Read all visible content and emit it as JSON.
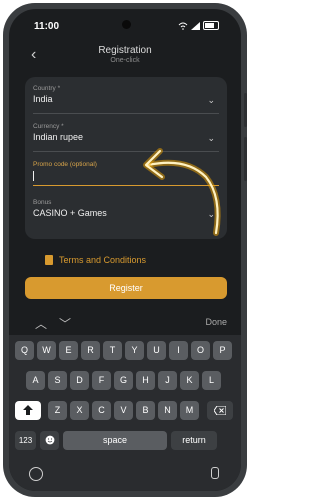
{
  "status_bar": {
    "time": "11:00"
  },
  "header": {
    "title": "Registration",
    "subtitle": "One-click"
  },
  "form": {
    "country": {
      "label": "Country *",
      "value": "India"
    },
    "currency": {
      "label": "Currency *",
      "value": "Indian rupee"
    },
    "promo": {
      "label": "Promo code (optional)",
      "value": ""
    },
    "bonus": {
      "label": "Bonus",
      "value": "CASINO + Games"
    }
  },
  "terms_label": "Terms and Conditions",
  "register_label": "Register",
  "accessory": {
    "done_label": "Done"
  },
  "keyboard": {
    "row1": [
      "Q",
      "W",
      "E",
      "R",
      "T",
      "Y",
      "U",
      "I",
      "O",
      "P"
    ],
    "row2": [
      "A",
      "S",
      "D",
      "F",
      "G",
      "H",
      "J",
      "K",
      "L"
    ],
    "row3": [
      "Z",
      "X",
      "C",
      "V",
      "B",
      "N",
      "M"
    ],
    "num_key": "123",
    "space_key": "space",
    "return_key": "return"
  },
  "colors": {
    "accent": "#d89a2f",
    "background": "#1b1d1f",
    "card": "#2b2e31"
  },
  "icons": [
    "back-icon",
    "chevron-down-icon",
    "document-icon",
    "arrow-up-icon",
    "arrow-down-icon",
    "shift-icon",
    "backspace-icon",
    "emoji-icon",
    "globe-icon",
    "mic-icon"
  ]
}
